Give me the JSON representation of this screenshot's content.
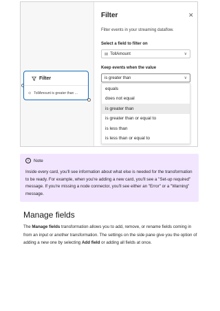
{
  "node": {
    "title": "Filter",
    "body": "TollAmount is greater than ...",
    "body_icon": "link-icon"
  },
  "panel": {
    "title": "Filter",
    "subtitle": "Filter events in your streaming dataflow.",
    "field_label": "Select a field to filter on",
    "field_value": "TollAmount",
    "keep_label": "Keep events when the value",
    "keep_value": "is greater than",
    "options": [
      "equals",
      "does not equal",
      "is greater than",
      "is greater than or equal to",
      "is less than",
      "is less than or equal to"
    ],
    "selected_index": 2
  },
  "note": {
    "title": "Note",
    "text": "Inside every card, you'll see information about what else is needed for the transformation to be ready. For example, when you're adding a new card, you'll see a \"Set-up required\" message. If you're missing a node connector, you'll see either an \"Error\" or a \"Warning\" message."
  },
  "section": {
    "heading": "Manage fields",
    "p1_a": "The ",
    "p1_b": "Manage fields",
    "p1_c": " transformation allows you to add, remove, or rename fields coming in from an input or another transformation. The settings on the side pane give you the option of adding a new one by selecting ",
    "p1_d": "Add field",
    "p1_e": " or adding all fields at once."
  },
  "colors": {
    "accent": "#0f6cbd",
    "note_bg": "#f2e6ff",
    "selected_bg": "#ebebeb"
  }
}
